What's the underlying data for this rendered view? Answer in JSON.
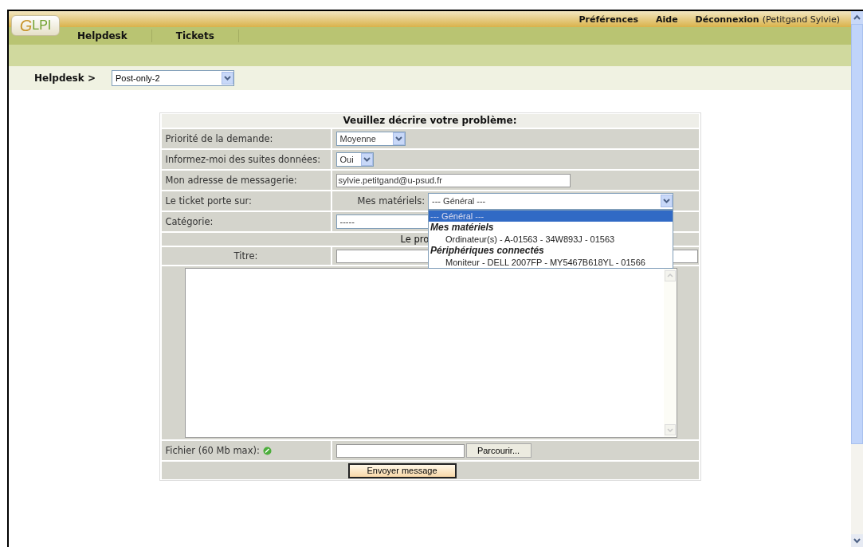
{
  "header_links": [
    {
      "label": "Préférences"
    },
    {
      "label": "Aide"
    },
    {
      "label": "Déconnexion",
      "user": "(Petitgand Sylvie)"
    }
  ],
  "logo": {
    "text": "GLPI"
  },
  "nav": [
    {
      "label": "Helpdesk",
      "selected": false
    },
    {
      "label": "Tickets",
      "selected": false
    }
  ],
  "breadcrumb": {
    "label": "Helpdesk >",
    "entity": "Post-only-2"
  },
  "form": {
    "title": "Veuillez décrire votre problème:",
    "rows": [
      {
        "kind": "select",
        "label": "Priorité de la demande:",
        "value": "Moyenne"
      },
      {
        "kind": "select",
        "label": "Informez-moi des suites données:",
        "value": "Oui"
      },
      {
        "kind": "input",
        "label": "Mon adresse de messagerie:",
        "value": "sylvie.petitgand@u-psud.fr"
      },
      {
        "kind": "hardware",
        "label": "Le ticket porte sur:",
        "sublabel": "Mes matériels:",
        "value": "--- Général ---",
        "expanded": true,
        "options": [
          {
            "kind": "option",
            "label": "--- Général ---",
            "selected": true
          },
          {
            "kind": "group",
            "label": "Mes matériels"
          },
          {
            "kind": "option",
            "label": "Ordinateur(s) - A-01563 - 34W893J - 01563",
            "selected": false
          },
          {
            "kind": "group",
            "label": "Périphériques connectés"
          },
          {
            "kind": "option",
            "label": "Moniteur - DELL 2007FP - MY5467B618YL - 01566",
            "selected": false
          }
        ]
      },
      {
        "kind": "select",
        "label": "Catégorie:",
        "value": "-----"
      },
      {
        "kind": "heading",
        "label": "Le pro"
      },
      {
        "kind": "title_input",
        "label": "Titre:"
      },
      {
        "kind": "textarea"
      },
      {
        "kind": "file",
        "label": "Fichier (60 Mb max):",
        "button": "Parcourir..."
      },
      {
        "kind": "submit",
        "button": "Envoyer message"
      }
    ]
  }
}
